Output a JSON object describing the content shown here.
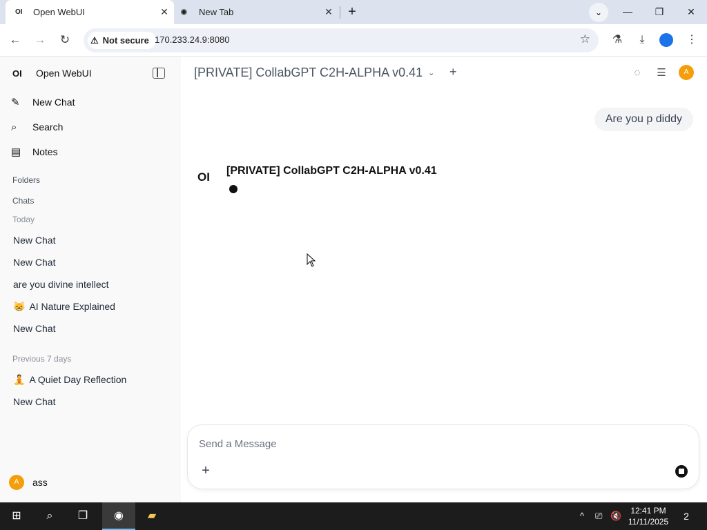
{
  "browser": {
    "tabs": [
      {
        "favicon": "OI",
        "title": "Open WebUI",
        "close": "✕"
      },
      {
        "favicon": "◉",
        "title": "New Tab",
        "close": "✕"
      }
    ],
    "new_tab": "+",
    "tab_search": "⌄",
    "window_controls": {
      "minimize": "—",
      "maximize": "❐",
      "close": "✕"
    },
    "nav": {
      "back": "←",
      "forward": "→",
      "reload": "↻"
    },
    "security_label": "Not secure",
    "security_icon": "⚠",
    "url": "170.233.24.9:8080",
    "bookmark_icon": "☆",
    "toolbar_icons": {
      "labs": "⚗",
      "download": "⤓",
      "menu": "⋮"
    }
  },
  "sidebar": {
    "brand_logo": "OI",
    "brand_name": "Open WebUI",
    "actions": [
      {
        "icon": "✎",
        "label": "New Chat"
      },
      {
        "icon": "⌕",
        "label": "Search"
      },
      {
        "icon": "▤",
        "label": "Notes"
      }
    ],
    "folders_label": "Folders",
    "chats_label": "Chats",
    "today_label": "Today",
    "today_chats": [
      "New Chat",
      "New Chat",
      "are you divine intellect",
      "AI Nature Explained",
      "New Chat"
    ],
    "today_emoji": {
      "3": "😸"
    },
    "previous_label": "Previous 7 days",
    "previous_chats": [
      "A Quiet Day Reflection",
      "New Chat"
    ],
    "previous_emoji": {
      "0": "🧘"
    },
    "user": {
      "initial": "A",
      "name": "ass"
    }
  },
  "main": {
    "model_title": "[PRIVATE] CollabGPT C2H-ALPHA v0.41",
    "model_chevron": "⌄",
    "add_model": "+",
    "header_icons": {
      "temporary": "◌",
      "controls": "☰"
    },
    "header_avatar": "A",
    "user_message": "Are you p diddy",
    "assistant_logo": "OI",
    "assistant_name": "[PRIVATE] CollabGPT C2H-ALPHA v0.41",
    "composer_placeholder": "Send a Message",
    "attach_icon": "+"
  },
  "taskbar": {
    "start_icon": "⊞",
    "search_icon": "⌕",
    "taskview_icon": "❐",
    "chrome_icon": "◉",
    "explorer_icon": "▰",
    "tray_icons": {
      "chevron": "^",
      "network": "⎚",
      "volume": "🔇"
    },
    "time": "12:41 PM",
    "date": "11/11/2025",
    "notifications": "2"
  },
  "colors": {
    "accent": "#f59e0b",
    "browser_frame": "#dde3ee",
    "taskbar": "#1c1c1c"
  }
}
